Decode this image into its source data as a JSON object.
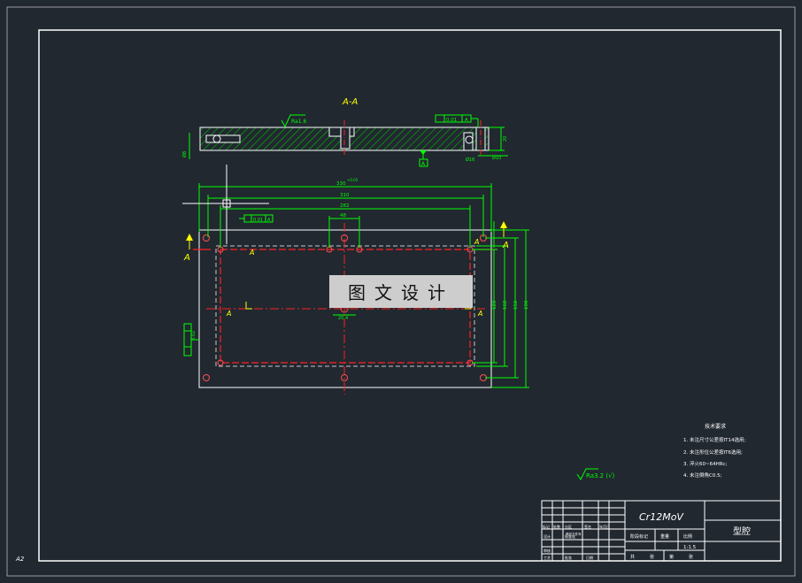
{
  "drawing": {
    "section_title": "A-A",
    "section_label": "A",
    "colors": {
      "background": "#212830",
      "frame": "#ffffff",
      "part_outline": "#ffffff",
      "dimension": "#00ff00",
      "centerline": "#ff2020",
      "hidden": "#c8c8c8",
      "hatch": "#00c000",
      "annotation": "#ffff00",
      "cursor": "#ffffff"
    },
    "section_view": {
      "roughness_left": "Ra1.6",
      "flatness": "0.01",
      "datum": "A",
      "thickness": "20",
      "dim_left": "Ø8",
      "dim_right_1": "Ø16",
      "dim_right_2": "Ø10"
    },
    "plan_view": {
      "dims_horizontal": [
        "330",
        "310",
        "282",
        "48"
      ],
      "dims_vertical": [
        "190",
        "152",
        "162",
        "120"
      ],
      "overall_tolerance": "+0.05",
      "center_dim": "20.4",
      "flatness_top": "0.01",
      "flatness_left": "0.02"
    }
  },
  "tech_requirements": {
    "title": "技术要求",
    "items": [
      "1. 未注尺寸公差按IT14选用;",
      "2. 未注形位公差按IT6选用;",
      "3. 淬火60~64HRc;",
      "4. 未注倒角C0.5;"
    ]
  },
  "roughness_general": "Ra3.2 (√)",
  "title_block": {
    "material": "Cr12MoV",
    "part_name": "型腔",
    "scale": "1:1.5",
    "row_labels": [
      "标记",
      "处数",
      "分区",
      "更改文件号",
      "签名",
      "年月日"
    ],
    "role_labels": [
      "设计",
      "标准化",
      "审核",
      "工艺",
      "批准"
    ],
    "header_labels": [
      "阶段标记",
      "重量",
      "比例"
    ],
    "sheet_labels": [
      "共",
      "张",
      "第",
      "张"
    ],
    "date_label": "日期"
  },
  "sheet_size": "A2",
  "watermark": "图文设计"
}
